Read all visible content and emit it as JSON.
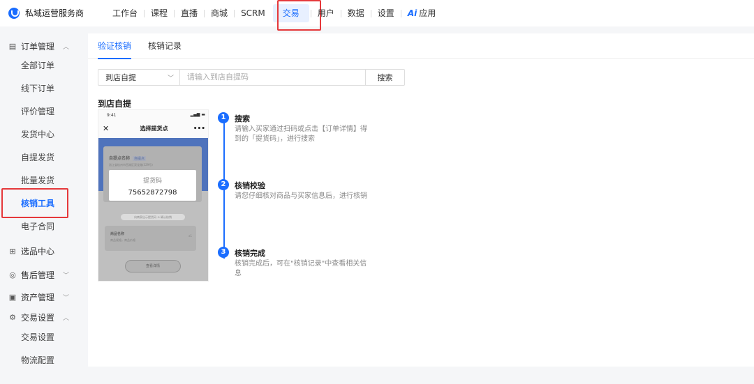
{
  "brand": {
    "name": "私域运营服务商"
  },
  "nav": {
    "items": [
      {
        "label": "工作台"
      },
      {
        "label": "课程"
      },
      {
        "label": "直播"
      },
      {
        "label": "商城"
      },
      {
        "label": "SCRM"
      },
      {
        "label": "交易"
      },
      {
        "label": "用户"
      },
      {
        "label": "数据"
      },
      {
        "label": "设置"
      },
      {
        "label": "应用"
      }
    ],
    "ai_badge": "Ai"
  },
  "sidebar": {
    "order_group": "订单管理",
    "order_items": [
      "全部订单",
      "线下订单",
      "评价管理",
      "发货中心",
      "自提发货",
      "批量发货",
      "核销工具",
      "电子合同"
    ],
    "groups": [
      "选品中心",
      "售后管理",
      "资产管理",
      "交易设置"
    ],
    "trade_items": [
      "交易设置",
      "物流配置"
    ]
  },
  "tabs": [
    "验证核销",
    "核销记录"
  ],
  "search": {
    "select_value": "到店自提",
    "placeholder": "请输入到店自提码",
    "button": "搜索"
  },
  "section_title": "到店自提",
  "phone": {
    "time": "9:41",
    "title": "选择提货点",
    "pickup_name": "自提点名称",
    "pickup_tag": "自提点",
    "address": "浙江省杭州市西湖区双龙路(329号)",
    "code_label": "提货码",
    "code_value": "75652872798",
    "confirm_text": "向商家出示提货码 ⊙ 确认核销",
    "goods_name": "商品名称",
    "goods_spec": "商品规格，商品价格",
    "goods_qty": "x1",
    "detail_button": "查看详情"
  },
  "steps": [
    {
      "num": "1",
      "title": "搜索",
      "desc": "请输入买家通过扫码或点击【订单详情】得到的「提货码」，进行搜索"
    },
    {
      "num": "2",
      "title": "核销校验",
      "desc": "请您仔细核对商品与买家信息后，进行核销"
    },
    {
      "num": "3",
      "title": "核销完成",
      "desc": "核销完成后，可在\"核销记录\"中查看相关信息"
    }
  ],
  "colors": {
    "accent": "#1a6dff",
    "highlight": "#e5383b"
  }
}
